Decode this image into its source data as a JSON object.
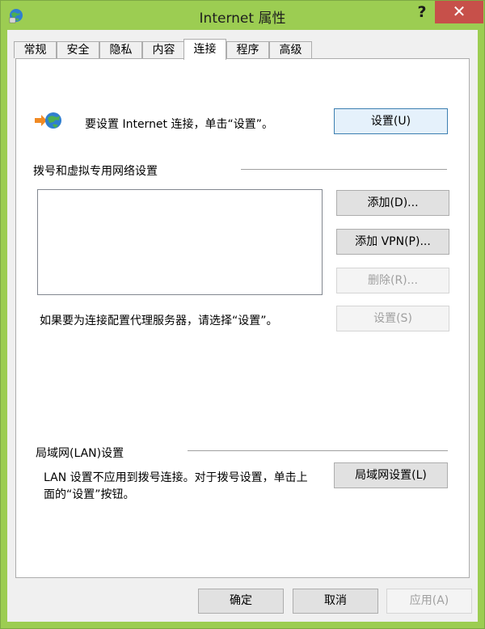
{
  "window": {
    "title": "Internet 属性",
    "help_label": "?",
    "close_label": "✕"
  },
  "tabs": [
    {
      "label": "常规"
    },
    {
      "label": "安全"
    },
    {
      "label": "隐私"
    },
    {
      "label": "内容"
    },
    {
      "label": "连接"
    },
    {
      "label": "程序"
    },
    {
      "label": "高级"
    }
  ],
  "active_tab": "连接",
  "setup": {
    "text": "要设置 Internet 连接，单击“设置”。",
    "button": "设置(U)"
  },
  "dialup": {
    "group_label": "拨号和虚拟专用网络设置",
    "add_button": "添加(D)...",
    "add_vpn_button": "添加 VPN(P)...",
    "delete_button": "删除(R)...",
    "proxy_text": "如果要为连接配置代理服务器，请选择“设置”。",
    "settings_button": "设置(S)"
  },
  "lan": {
    "group_label": "局域网(LAN)设置",
    "text_line1": "LAN 设置不应用到拨号连接。对于拨号设置，单击上",
    "text_line2": "面的“设置”按钮。",
    "button": "局域网设置(L)"
  },
  "footer": {
    "ok": "确定",
    "cancel": "取消",
    "apply": "应用(A)"
  },
  "colors": {
    "titlebar": "#9ccd52",
    "close_button": "#c7504a",
    "default_button_border": "#3c7fb1"
  }
}
